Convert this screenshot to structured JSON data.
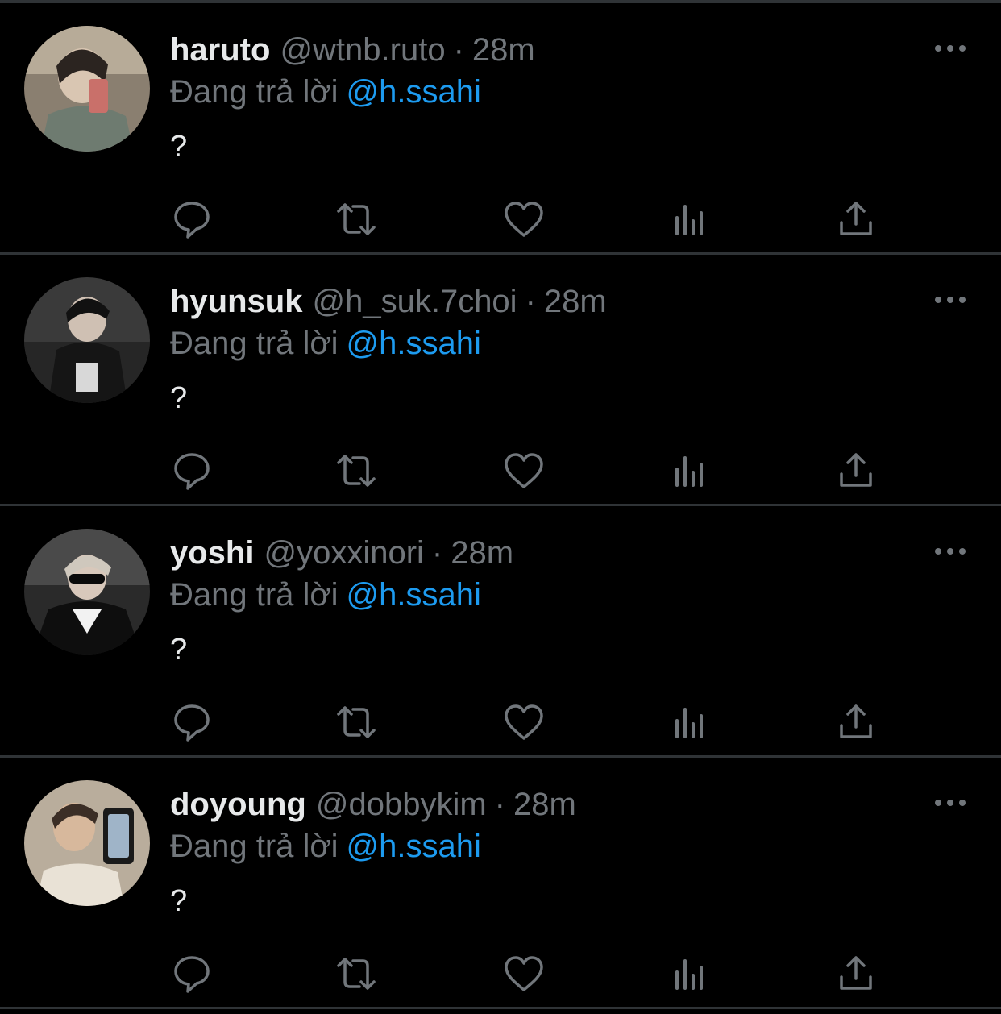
{
  "colors": {
    "background": "#000000",
    "divider": "#2f3336",
    "primary_text": "#e7e9ea",
    "secondary_text": "#71767b",
    "accent": "#1d9bf0"
  },
  "icons": {
    "more": "more-dots-icon",
    "reply": "reply-icon",
    "retweet": "retweet-icon",
    "like": "heart-icon",
    "views": "views-chart-icon",
    "share": "share-icon"
  },
  "tweets": [
    {
      "display_name": "haruto",
      "handle": "@wtnb.ruto",
      "separator": "·",
      "time": "28m",
      "reply_prefix": "Đang trả lời",
      "reply_to": "@h.ssahi",
      "text": "?"
    },
    {
      "display_name": "hyunsuk",
      "handle": "@h_suk.7choi",
      "separator": "·",
      "time": "28m",
      "reply_prefix": "Đang trả lời",
      "reply_to": "@h.ssahi",
      "text": "?"
    },
    {
      "display_name": "yoshi",
      "handle": "@yoxxinori",
      "separator": "·",
      "time": "28m",
      "reply_prefix": "Đang trả lời",
      "reply_to": "@h.ssahi",
      "text": "?"
    },
    {
      "display_name": "doyoung",
      "handle": "@dobbykim",
      "separator": "·",
      "time": "28m",
      "reply_prefix": "Đang trả lời",
      "reply_to": "@h.ssahi",
      "text": "?"
    }
  ]
}
